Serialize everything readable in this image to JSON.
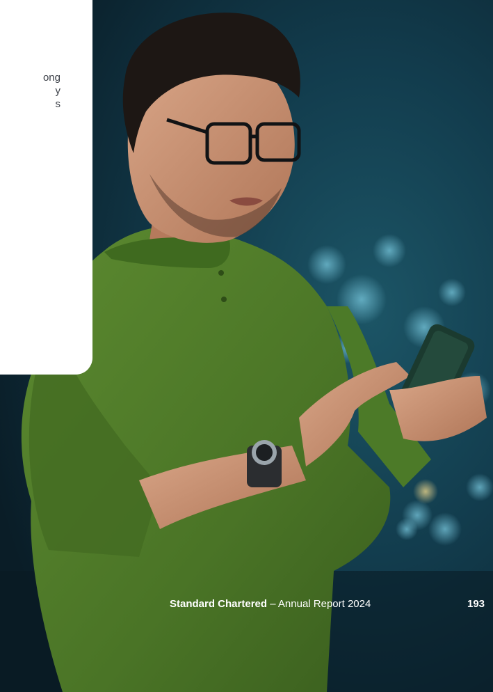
{
  "card": {
    "lines": [
      "ong",
      "y",
      "s"
    ]
  },
  "footer": {
    "brand": "Standard Chartered",
    "separator": " – ",
    "report_title": "Annual Report 2024",
    "page_number": "193"
  },
  "colors": {
    "background_dark": "#0c2330",
    "shirt_green": "#4f7a2a",
    "card_white": "#ffffff",
    "footer_text": "#ffffff"
  }
}
